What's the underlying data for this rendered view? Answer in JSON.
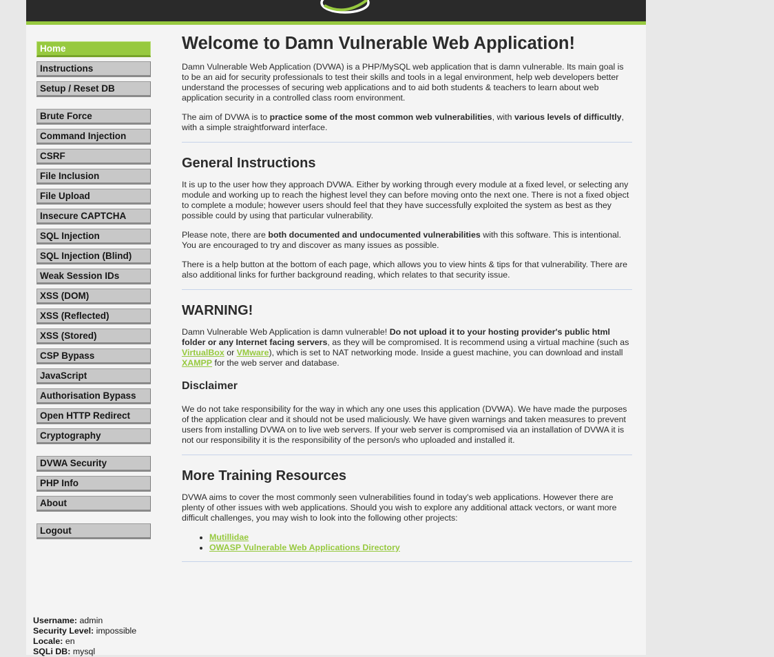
{
  "menu": {
    "group1": [
      "Home",
      "Instructions",
      "Setup / Reset DB"
    ],
    "group2": [
      "Brute Force",
      "Command Injection",
      "CSRF",
      "File Inclusion",
      "File Upload",
      "Insecure CAPTCHA",
      "SQL Injection",
      "SQL Injection (Blind)",
      "Weak Session IDs",
      "XSS (DOM)",
      "XSS (Reflected)",
      "XSS (Stored)",
      "CSP Bypass",
      "JavaScript",
      "Authorisation Bypass",
      "Open HTTP Redirect",
      "Cryptography"
    ],
    "group3": [
      "DVWA Security",
      "PHP Info",
      "About"
    ],
    "group4": [
      "Logout"
    ],
    "active": "Home"
  },
  "main": {
    "title": "Welcome to Damn Vulnerable Web Application!",
    "intro_p1": "Damn Vulnerable Web Application (DVWA) is a PHP/MySQL web application that is damn vulnerable. Its main goal is to be an aid for security professionals to test their skills and tools in a legal environment, help web developers better understand the processes of securing web applications and to aid both students & teachers to learn about web application security in a controlled class room environment.",
    "intro_p2_a": "The aim of DVWA is to ",
    "intro_p2_b": "practice some of the most common web vulnerabilities",
    "intro_p2_c": ", with ",
    "intro_p2_d": "various levels of difficultly",
    "intro_p2_e": ", with a simple straightforward interface.",
    "gi_title": "General Instructions",
    "gi_p1": "It is up to the user how they approach DVWA. Either by working through every module at a fixed level, or selecting any module and working up to reach the highest level they can before moving onto the next one. There is not a fixed object to complete a module; however users should feel that they have successfully exploited the system as best as they possible could by using that particular vulnerability.",
    "gi_p2_a": "Please note, there are ",
    "gi_p2_b": "both documented and undocumented vulnerabilities",
    "gi_p2_c": " with this software. This is intentional. You are encouraged to try and discover as many issues as possible.",
    "gi_p3": "There is a help button at the bottom of each page, which allows you to view hints & tips for that vulnerability. There are also additional links for further background reading, which relates to that security issue.",
    "warn_title": "WARNING!",
    "warn_a": "Damn Vulnerable Web Application is damn vulnerable! ",
    "warn_b": "Do not upload it to your hosting provider's public html folder or any Internet facing servers",
    "warn_c": ", as they will be compromised. It is recommend using a virtual machine (such as ",
    "warn_link1": "VirtualBox",
    "warn_d": " or ",
    "warn_link2": "VMware",
    "warn_e": "), which is set to NAT networking mode. Inside a guest machine, you can download and install ",
    "warn_link3": "XAMPP",
    "warn_f": " for the web server and database.",
    "disc_title": "Disclaimer",
    "disc_p": "We do not take responsibility for the way in which any one uses this application (DVWA). We have made the purposes of the application clear and it should not be used maliciously. We have given warnings and taken measures to prevent users from installing DVWA on to live web servers. If your web server is compromised via an installation of DVWA it is not our responsibility it is the responsibility of the person/s who uploaded and installed it.",
    "mtr_title": "More Training Resources",
    "mtr_p": "DVWA aims to cover the most commonly seen vulnerabilities found in today's web applications. However there are plenty of other issues with web applications. Should you wish to explore any additional attack vectors, or want more difficult challenges, you may wish to look into the following other projects:",
    "mtr_links": [
      "Mutillidae",
      "OWASP Vulnerable Web Applications Directory"
    ]
  },
  "userinfo": {
    "username_label": "Username:",
    "username": " admin",
    "security_label": "Security Level:",
    "security": " impossible",
    "locale_label": "Locale:",
    "locale": " en",
    "sqli_label": "SQLi DB:",
    "sqli": " mysql"
  },
  "colors": {
    "accent": "#97c93f",
    "header": "#2a2a2a"
  }
}
